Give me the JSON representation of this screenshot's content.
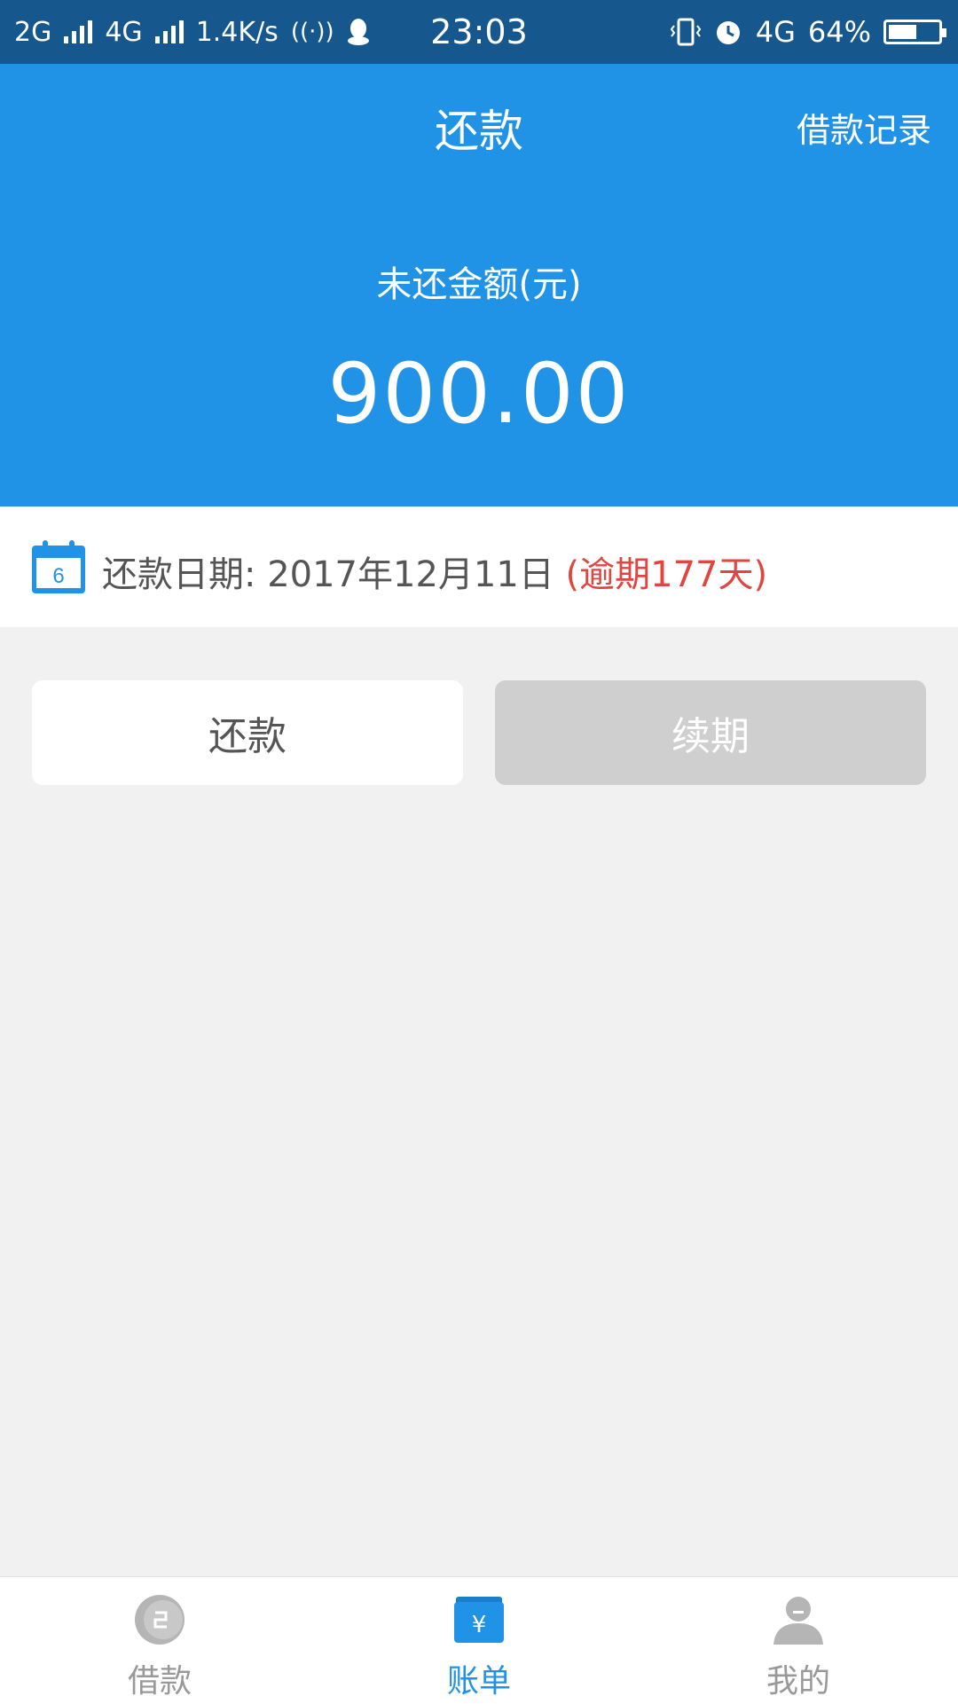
{
  "status_bar": {
    "net1": "2G",
    "net2": "4G",
    "speed": "1.4K/s",
    "time": "23:03",
    "net3": "4G",
    "battery_pct": "64%",
    "battery_level": 0.64
  },
  "header": {
    "title": "还款",
    "records_link": "借款记录",
    "amount_label": "未还金额(元)",
    "amount": "900.00"
  },
  "due": {
    "calendar_day": "6",
    "label": "还款日期:",
    "date": "2017年12月11日",
    "overdue": "(逾期177天)"
  },
  "actions": {
    "repay": "还款",
    "renew": "续期"
  },
  "nav": {
    "items": [
      {
        "label": "借款",
        "active": false
      },
      {
        "label": "账单",
        "active": true
      },
      {
        "label": "我的",
        "active": false
      }
    ]
  },
  "colors": {
    "status_bar": "#16578e",
    "header": "#2193e6",
    "overdue": "#e0453f",
    "disabled_button": "#cfcfcf"
  }
}
